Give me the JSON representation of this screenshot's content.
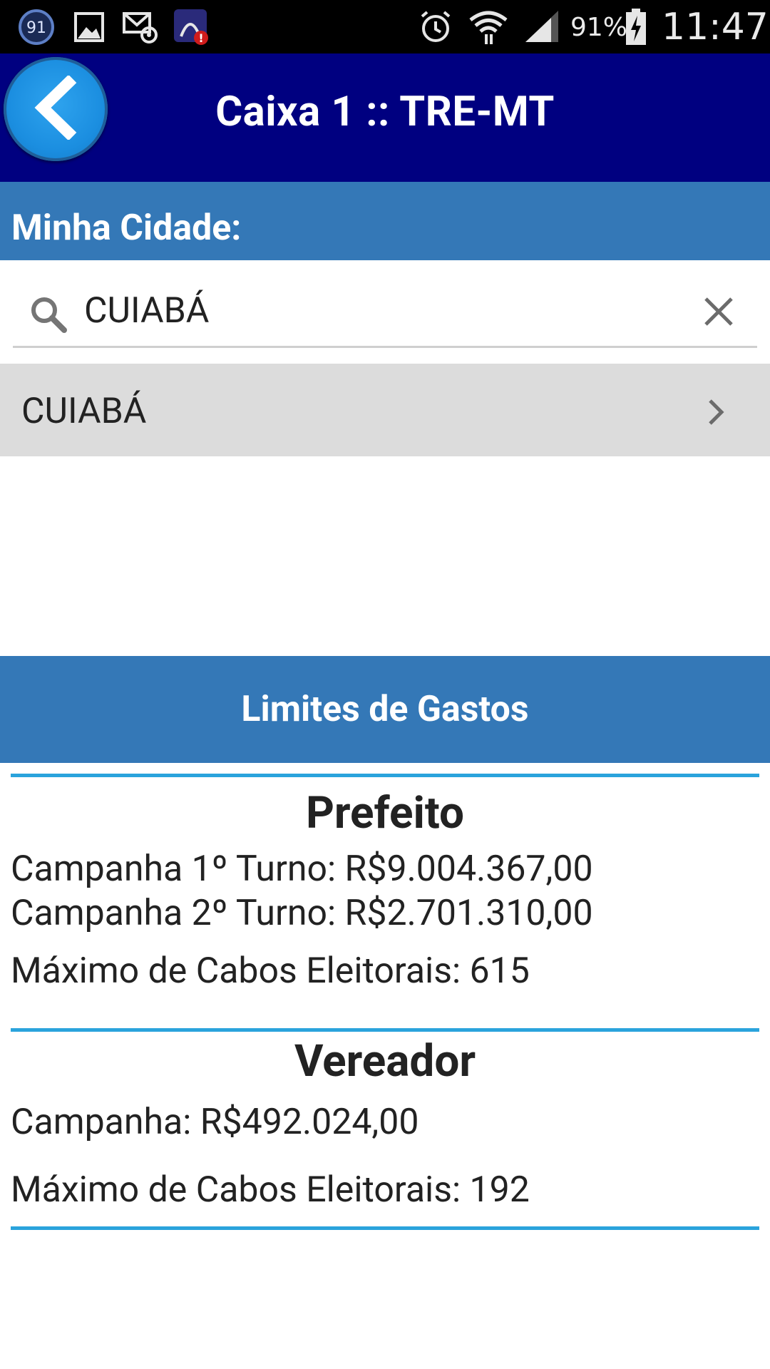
{
  "status_bar": {
    "notification_badge": "91",
    "battery_percent": "91%",
    "time": "11:47",
    "icons": [
      "notification-counter-icon",
      "image-icon",
      "email-at-icon",
      "app-alert-icon",
      "alarm-icon",
      "wifi-icon",
      "signal-icon",
      "battery-charging-icon"
    ]
  },
  "app_bar": {
    "title": "Caixa 1 :: TRE-MT",
    "back_icon": "chevron-left-icon"
  },
  "city_section": {
    "heading": "Minha Cidade:",
    "search_value": "CUIABÁ",
    "result_item": "CUIABÁ"
  },
  "limits": {
    "heading": "Limites de Gastos",
    "prefeito": {
      "title": "Prefeito",
      "turno1": "Campanha 1º Turno: R$9.004.367,00",
      "turno2": "Campanha 2º Turno: R$2.701.310,00",
      "cabos": "Máximo de Cabos Eleitorais: 615"
    },
    "vereador": {
      "title": "Vereador",
      "campanha": "Campanha: R$492.024,00",
      "cabos": "Máximo de Cabos Eleitorais: 192"
    }
  },
  "colors": {
    "app_bar": "#000080",
    "section_blue": "#3478b7",
    "divider": "#2aa3dc",
    "list_bg": "#dcdcdc"
  }
}
